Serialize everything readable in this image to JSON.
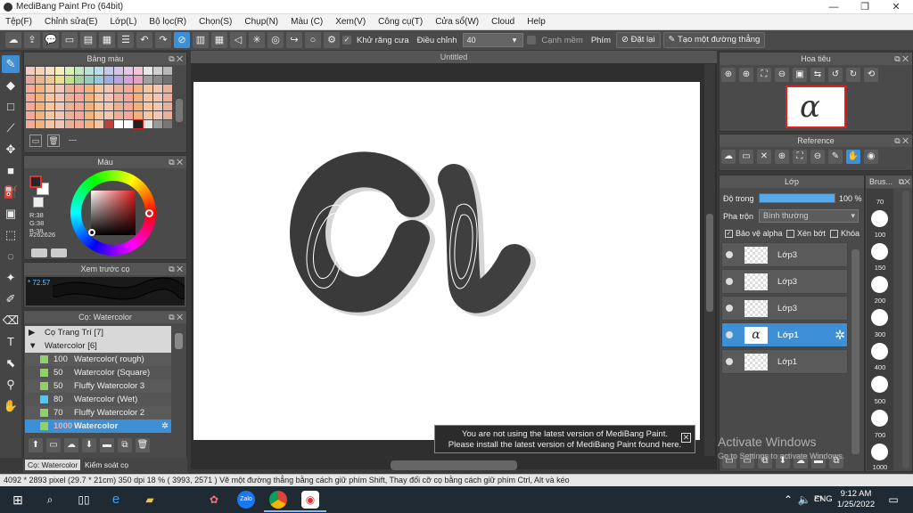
{
  "app": {
    "title": "MediBang Paint Pro (64bit)"
  },
  "menu": [
    "Tệp(F)",
    "Chỉnh sửa(E)",
    "Lớp(L)",
    "Bộ lọc(R)",
    "Chọn(S)",
    "Chụp(N)",
    "Màu (C)",
    "Xem(V)",
    "Công cụ(T)",
    "Cửa sổ(W)",
    "Cloud",
    "Help"
  ],
  "toolbar": {
    "antialias_label": "Khử răng cưa",
    "adjust_label": "Điều chỉnh",
    "adjust_value": "40",
    "edge_label": "Cạnh mềm",
    "key_label": "Phím",
    "reset_label": "Đặt lại",
    "straight_label": "Tạo một đường thẳng"
  },
  "palette": {
    "title": "Bảng màu",
    "footer": "---"
  },
  "color": {
    "title": "Màu",
    "r": "R:38",
    "g": "G:38",
    "b": "B:38",
    "hex": "#262626",
    "fg": "#262626",
    "bg": "#ffffff"
  },
  "preview": {
    "title": "Xem trước cọ",
    "value": "72.57"
  },
  "brushes": {
    "title": "Cọ: Watercolor",
    "groups": [
      {
        "label": "Cọ Trang Trí [7]",
        "expanded": false
      },
      {
        "label": "Watercolor [6]",
        "expanded": true
      }
    ],
    "items": [
      {
        "size": "100",
        "name": "Watercolor( rough)",
        "color": "#8ed06a"
      },
      {
        "size": "50",
        "name": "Watercolor (Square)",
        "color": "#8ed06a"
      },
      {
        "size": "50",
        "name": "Fluffy Watercolor 3",
        "color": "#8ed06a"
      },
      {
        "size": "80",
        "name": "Watercolor (Wet)",
        "color": "#56c5f0"
      },
      {
        "size": "70",
        "name": "Fluffy Watercolor 2",
        "color": "#8ed06a"
      },
      {
        "size": "1000",
        "name": "Watercolor",
        "color": "#8ed06a",
        "selected": true
      }
    ],
    "tabs": [
      "Cọ: Watercolor",
      "Kiểm soát cọ"
    ]
  },
  "canvas": {
    "title": "Untitled"
  },
  "notice": {
    "line1": "You are not using the latest version of MediBang Paint.",
    "line2": "Please install the latest version of MediBang Paint found here."
  },
  "navigator": {
    "title": "Hoa tiêu"
  },
  "reference": {
    "title": "Reference"
  },
  "layers_panel": {
    "title": "Lớp",
    "opacity_label": "Độ trong",
    "opacity_value": "100 %",
    "opacity": 1.0,
    "blend_label": "Pha trộn",
    "blend_value": "Bình thường",
    "protect_alpha": "Bảo vệ alpha",
    "clip": "Xén bớt",
    "lock": "Khóa",
    "layers": [
      {
        "name": "Lớp3",
        "selected": false
      },
      {
        "name": "Lớp3",
        "selected": false
      },
      {
        "name": "Lớp3",
        "selected": false
      },
      {
        "name": "Lớp1",
        "selected": true
      },
      {
        "name": "Lớp1",
        "selected": false
      }
    ]
  },
  "brush_sizes": {
    "title": "Brus...",
    "sizes": [
      "70",
      "100",
      "150",
      "200",
      "300",
      "400",
      "500",
      "700",
      "1000"
    ]
  },
  "watermark": {
    "line1": "Activate Windows",
    "line2": "Go to Settings to activate Windows."
  },
  "status": {
    "text": "4092 * 2893 pixel   (29.7 * 21cm)   350 dpi   18 %   ( 3993, 2571 )   Vẽ một đường thẳng bằng cách giữ phím Shift, Thay đổi cỡ cọ bằng cách giữ phím Ctrl, Alt và kéo"
  },
  "taskbar": {
    "lang": "ENG",
    "time": "9:12 AM",
    "date": "1/25/2022",
    "zalo": "Zalo"
  }
}
